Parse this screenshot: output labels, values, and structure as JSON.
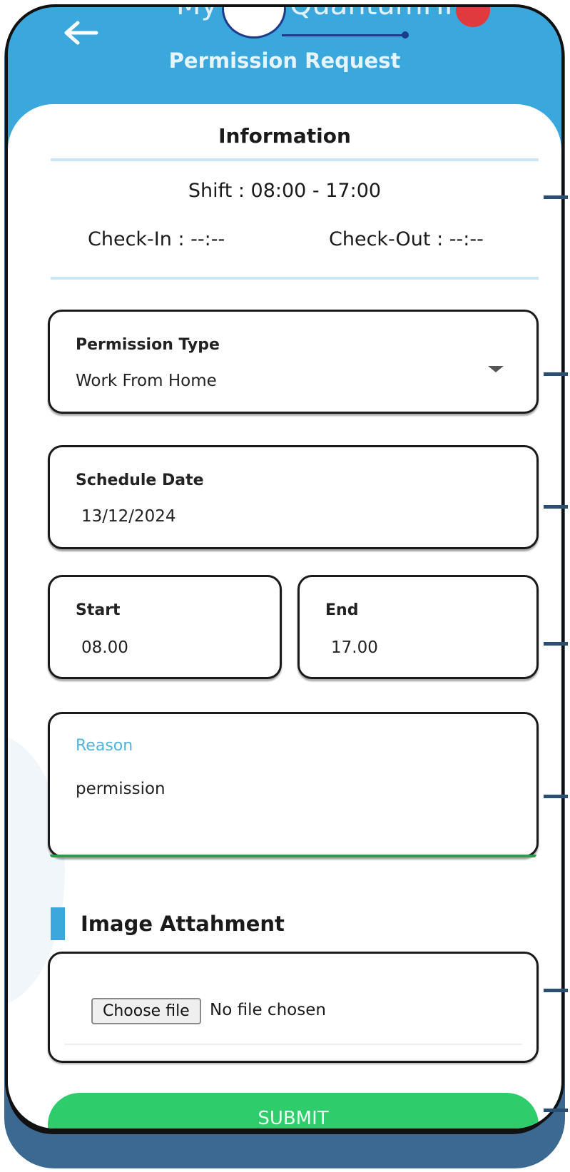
{
  "header": {
    "app_name_left": "My",
    "app_name_right": "QuantumHR",
    "page_title": "Permission Request"
  },
  "information": {
    "title": "Information",
    "shift": "Shift : 08:00 - 17:00",
    "check_in": "Check-In : --:--",
    "check_out": "Check-Out : --:--"
  },
  "form": {
    "permission_type": {
      "label": "Permission Type",
      "value": "Work From Home"
    },
    "schedule_date": {
      "label": "Schedule Date",
      "value": "13/12/2024"
    },
    "start": {
      "label": "Start",
      "value": "08.00"
    },
    "end": {
      "label": "End",
      "value": "17.00"
    },
    "reason": {
      "label": "Reason",
      "value": "permission"
    }
  },
  "attachment": {
    "title": "Image Attahment",
    "button_label": "Choose file",
    "status": "No file chosen"
  },
  "submit_label": "SUBMIT",
  "colors": {
    "header_blue": "#3aa7dd",
    "submit_green": "#2ecc6a",
    "reason_label": "#4fb3dc",
    "notify_red": "#e0393e"
  },
  "icons": [
    "back-arrow-icon",
    "logo-icon",
    "chevron-down-icon"
  ]
}
